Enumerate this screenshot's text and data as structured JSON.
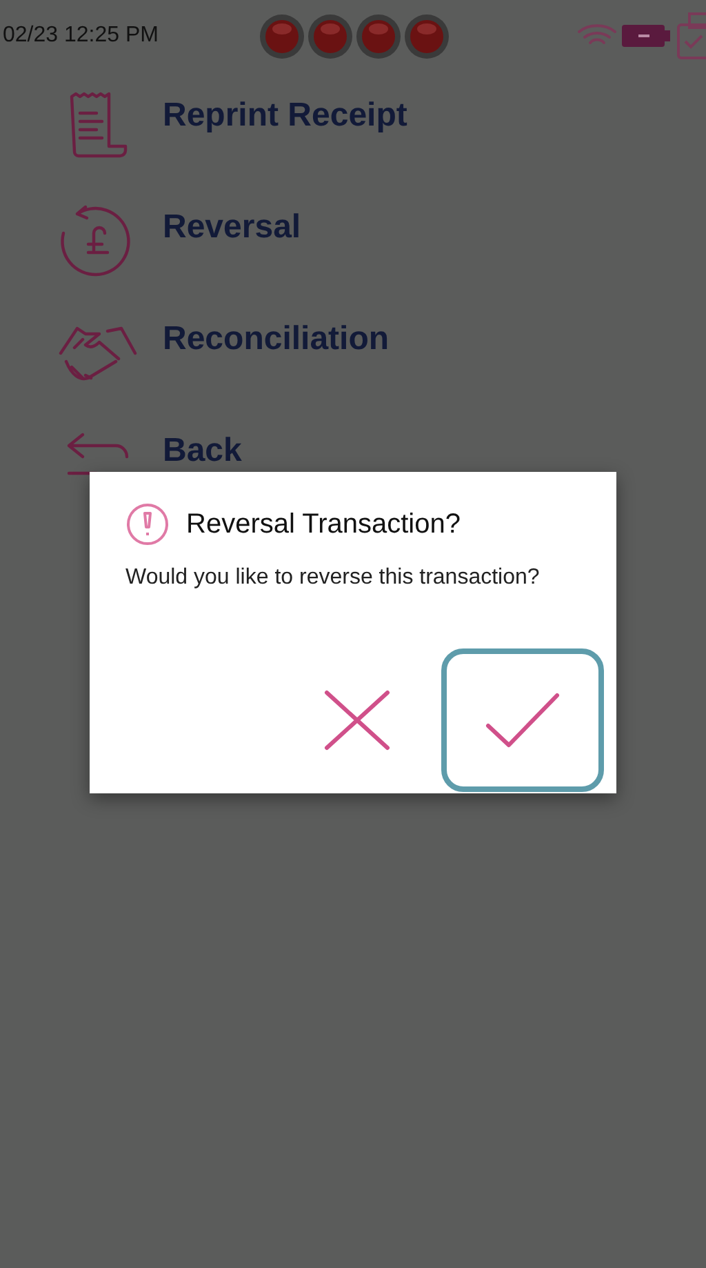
{
  "status_bar": {
    "time": "02/23 12:25 PM"
  },
  "menu": [
    {
      "kind": "receipt",
      "label": "Reprint Receipt"
    },
    {
      "kind": "reversal",
      "label": "Reversal"
    },
    {
      "kind": "handshake",
      "label": "Reconciliation"
    },
    {
      "kind": "back",
      "label": "Back"
    }
  ],
  "dialog": {
    "title": "Reversal Transaction?",
    "message": "Would you like to reverse this transaction?",
    "buttons": [
      {
        "kind": "cancel",
        "selected": false
      },
      {
        "kind": "confirm",
        "selected": true
      }
    ]
  }
}
